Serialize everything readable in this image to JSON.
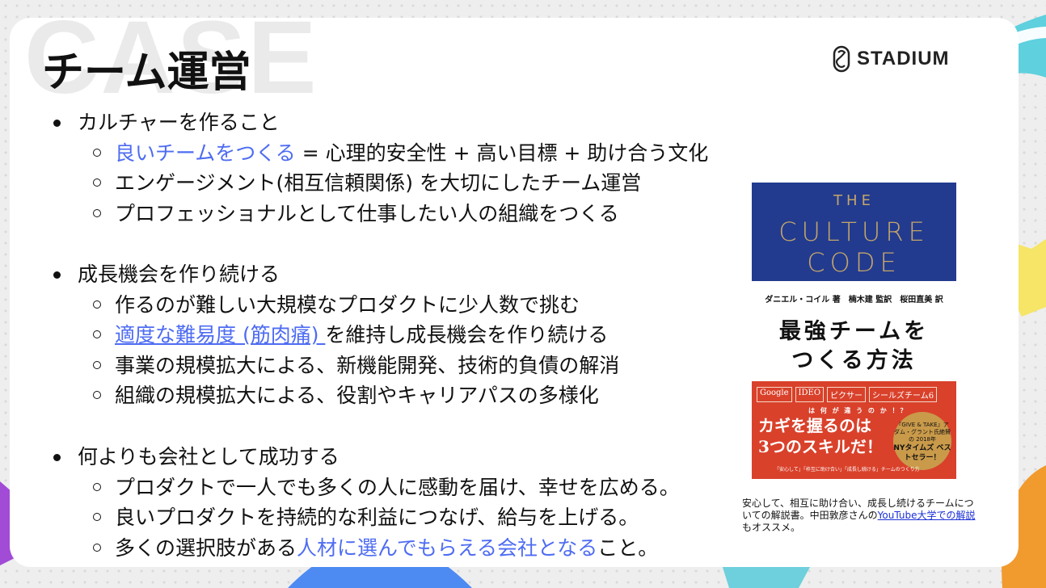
{
  "watermark": "CASE",
  "title": "チーム運営",
  "logo": {
    "text": "STADIUM"
  },
  "sections": [
    {
      "label": "カルチャーを作ること",
      "items": [
        {
          "parts": [
            {
              "t": "良いチームをつくる",
              "hl": true
            },
            {
              "t": " = 心理的安全性 + 高い目標 + 助け合う文化"
            }
          ]
        },
        {
          "parts": [
            {
              "t": "エンゲージメント(相互信頼関係) を大切にしたチーム運営"
            }
          ]
        },
        {
          "parts": [
            {
              "t": "プロフェッショナルとして仕事したい人の組織をつくる"
            }
          ]
        }
      ]
    },
    {
      "label": "成長機会を作り続ける",
      "items": [
        {
          "parts": [
            {
              "t": "作るのが難しい大規模なプロダクトに少人数で挑む"
            }
          ]
        },
        {
          "parts": [
            {
              "t": "適度な難易度 (筋肉痛) ",
              "hl": true,
              "ul": true
            },
            {
              "t": "を維持し成長機会を作り続ける"
            }
          ]
        },
        {
          "parts": [
            {
              "t": "事業の規模拡大による、新機能開発、技術的負債の解消"
            }
          ]
        },
        {
          "parts": [
            {
              "t": "組織の規模拡大による、役割やキャリアパスの多様化"
            }
          ]
        }
      ]
    },
    {
      "label": "何よりも会社として成功する",
      "items": [
        {
          "parts": [
            {
              "t": "プロダクトで一人でも多くの人に感動を届け、幸せを広める。"
            }
          ]
        },
        {
          "parts": [
            {
              "t": "良いプロダクトを持続的な利益につなげ、給与を上げる。"
            }
          ]
        },
        {
          "parts": [
            {
              "t": "多くの選択肢がある"
            },
            {
              "t": "人材に選んでもらえる会社となる",
              "hl": true
            },
            {
              "t": "こと。"
            }
          ]
        }
      ]
    }
  ],
  "book": {
    "the": "THE",
    "culture": "CULTURE",
    "code": "CODE",
    "authors": "ダニエル・コイル 著　楠木建 監訳　桜田直美 訳",
    "jp_title_line1": "最強チームを",
    "jp_title_line2": "つくる方法",
    "tags": [
      "Google",
      "IDEO",
      "ピクサー",
      "シールズチーム6"
    ],
    "question": "は 何 が 違 う の か ！？",
    "headline_line1": "カギを握るのは",
    "headline_line2": "3つのスキルだ！",
    "seal_top": "『GIVE & TAKE』アダム・グラント氏絶賛の 2018年",
    "seal_main": "NYタイムズ ベストセラー！",
    "footer": "「安心して」「枠互に助け合い」「成長し続ける」チームのつくり方"
  },
  "caption": {
    "text": "安心して、相互に助け合い、成長し続けるチームについての解説書。中田敦彦さんの",
    "link": "YouTube大学での解説",
    "suffix": "もオススメ。"
  },
  "colors": {
    "highlight": "#4e6cf2",
    "book_blue": "#223b8f",
    "book_red": "#d9412b",
    "book_gold": "#c4a56a"
  }
}
